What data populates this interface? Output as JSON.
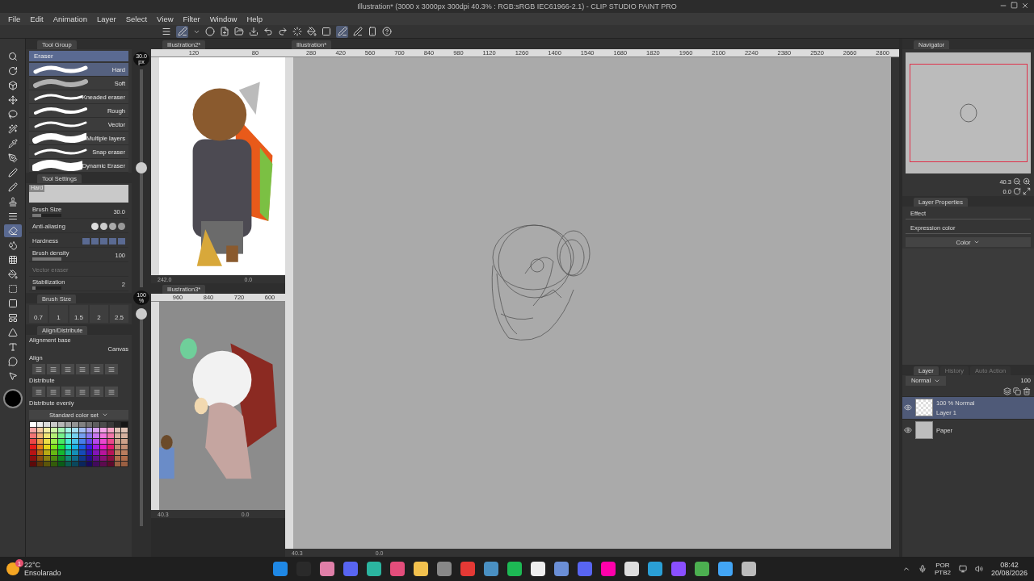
{
  "window": {
    "title": "Illustration* (3000 x 3000px 300dpi 40.3% : RGB:sRGB IEC61966-2.1)  - CLIP STUDIO PAINT PRO"
  },
  "menu": [
    "File",
    "Edit",
    "Animation",
    "Layer",
    "Select",
    "View",
    "Filter",
    "Window",
    "Help"
  ],
  "tools": [
    {
      "selected": false
    },
    {
      "selected": false
    },
    {
      "selected": false
    },
    {
      "selected": false
    },
    {
      "selected": false
    },
    {
      "selected": false
    },
    {
      "selected": false
    },
    {
      "selected": false
    },
    {
      "selected": false
    },
    {
      "selected": false
    },
    {
      "selected": false
    },
    {
      "selected": false
    },
    {
      "selected": true
    },
    {
      "selected": false
    },
    {
      "selected": false
    },
    {
      "selected": false
    },
    {
      "selected": false
    },
    {
      "selected": false
    },
    {
      "selected": false
    },
    {
      "selected": false
    },
    {
      "selected": false
    },
    {
      "selected": false
    },
    {
      "selected": false
    }
  ],
  "tool_group": {
    "tab": "Tool Group",
    "group": "Eraser",
    "sub_tools": [
      {
        "label": "Hard",
        "selected": true
      },
      {
        "label": "Soft",
        "selected": false
      },
      {
        "label": "Kneaded eraser",
        "selected": false
      },
      {
        "label": "Rough",
        "selected": false
      },
      {
        "label": "Vector",
        "selected": false
      },
      {
        "label": "Multiple layers",
        "selected": false
      },
      {
        "label": "Snap eraser",
        "selected": false
      },
      {
        "label": "Dynamic Eraser",
        "selected": false
      }
    ]
  },
  "tool_settings": {
    "tab": "Tool Settings",
    "preview": "Hard",
    "properties": [
      {
        "kind": "value",
        "label": "Brush Size",
        "value": "30.0",
        "level": 0.3
      },
      {
        "kind": "aa",
        "label": "Anti-aliasing"
      },
      {
        "kind": "steps",
        "label": "Hardness"
      },
      {
        "kind": "value",
        "label": "Brush density",
        "value": "100",
        "level": 1
      },
      {
        "kind": "check",
        "label": "Vector eraser",
        "disabled": true
      },
      {
        "kind": "value",
        "label": "Stabilization",
        "value": "2",
        "level": 0.1
      }
    ]
  },
  "brush_size_panel": {
    "tab": "Brush Size",
    "sizes": [
      "0.7",
      "1",
      "1.5",
      "2",
      "2.5"
    ]
  },
  "align_panel": {
    "tab": "Align/Distribute",
    "alignment_base": "Alignment base",
    "base_value": "Canvas",
    "align": "Align",
    "distribute": "Distribute",
    "distribute_evenly": "Distribute evenly"
  },
  "color_set": {
    "name": "Standard color set"
  },
  "sliders": [
    {
      "value": "30.0",
      "unit": "px",
      "level": 0.55
    },
    {
      "value": "100",
      "unit": "%",
      "level": 1
    }
  ],
  "sub_views": [
    {
      "tab": "Illustration2*",
      "ruler": [
        "120",
        "80"
      ],
      "footer": [
        "242.0",
        "0.0"
      ]
    },
    {
      "tab": "Illustration3*",
      "ruler": [
        "960",
        "840",
        "720",
        "600"
      ],
      "footer": [
        "40.3",
        "0.0"
      ]
    }
  ],
  "canvas": {
    "tab": "Illustration*",
    "ruler": [
      "280",
      "420",
      "560",
      "700",
      "840",
      "980",
      "1120",
      "1260",
      "1400",
      "1540",
      "1680",
      "1820",
      "1960",
      "2100",
      "2240",
      "2380",
      "2520",
      "2660",
      "2800"
    ],
    "footer": [
      "40.3",
      "0.0"
    ]
  },
  "navigator": {
    "tab": "Navigator",
    "zoom": "40.3",
    "angle": "0.0"
  },
  "layer_properties": {
    "tab": "Layer Properties",
    "effect": "Effect",
    "expression_color": "Expression color",
    "color_mode": "Color"
  },
  "layer_panel": {
    "tabs": [
      {
        "label": "Layer",
        "selected": true
      },
      {
        "label": "History",
        "selected": false
      },
      {
        "label": "Auto Action",
        "selected": false
      }
    ],
    "blend_mode": "Normal",
    "opacity": "100",
    "layers": [
      {
        "info": "100 % Normal",
        "name": "Layer 1",
        "selected": true,
        "visible": true,
        "kind": "raster"
      },
      {
        "name": "Paper",
        "selected": false,
        "visible": true,
        "kind": "paper"
      }
    ]
  },
  "taskbar": {
    "badge": "1",
    "temperature": "22°C",
    "weather": "Ensolarado",
    "language": "POR",
    "layout": "PTB2",
    "time": "08:42",
    "date": "20/08/2026"
  }
}
